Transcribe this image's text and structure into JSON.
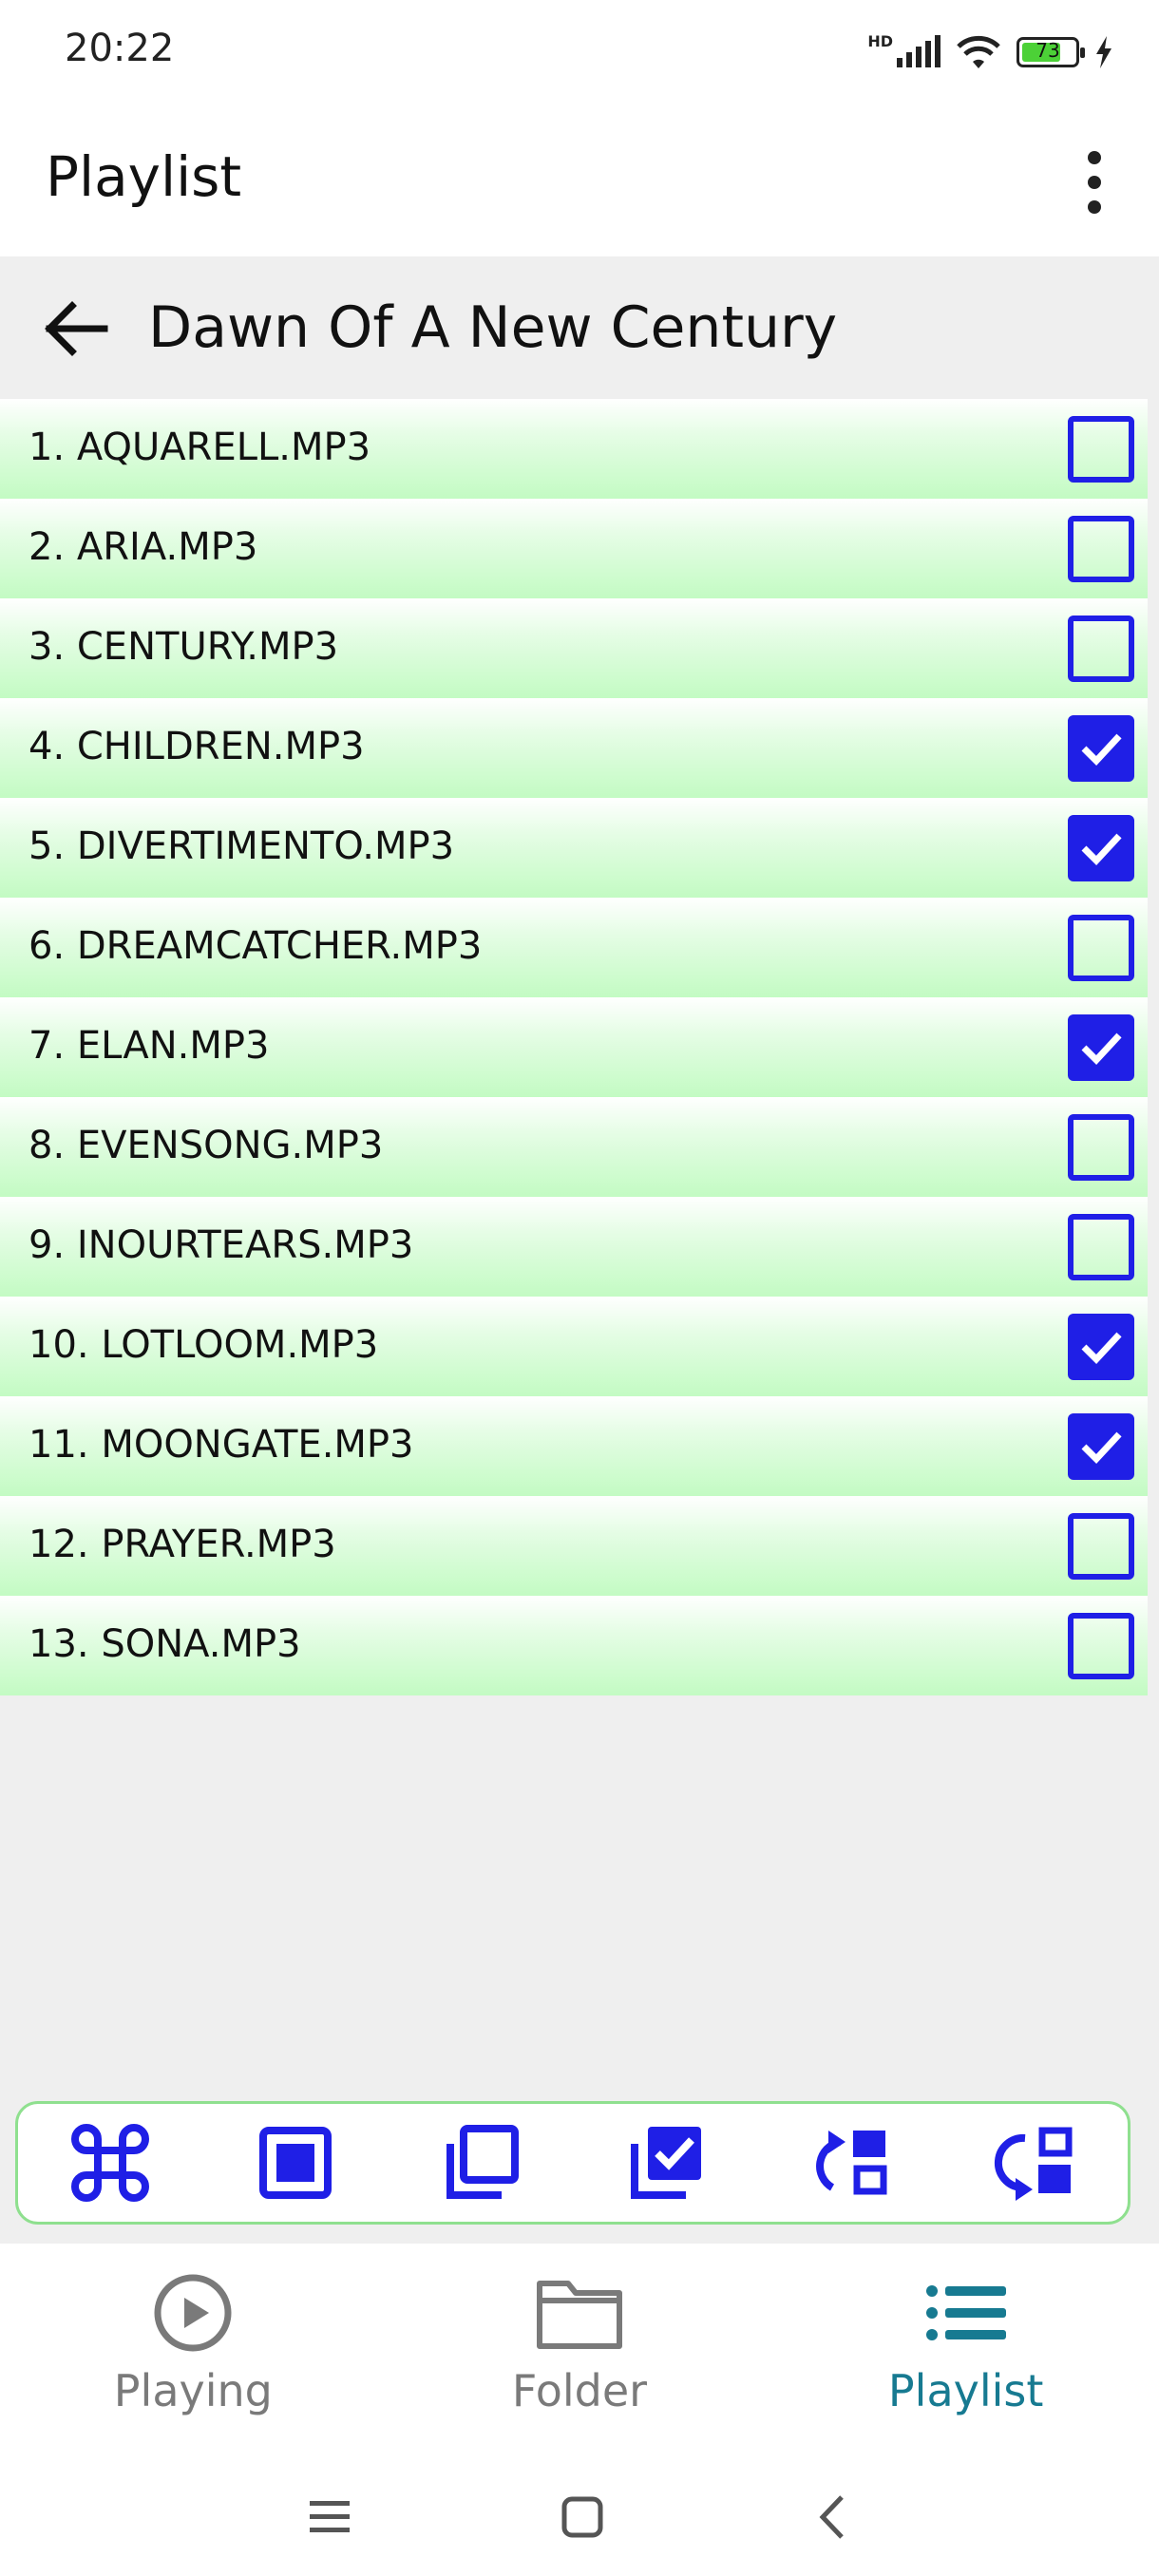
{
  "status": {
    "time": "20:22",
    "battery": "73",
    "network": "HD"
  },
  "app_bar": {
    "title": "Playlist"
  },
  "playlist": {
    "name": "Dawn Of A New Century"
  },
  "tracks": [
    {
      "label": "1. AQUARELL.MP3",
      "checked": false
    },
    {
      "label": "2. ARIA.MP3",
      "checked": false
    },
    {
      "label": "3. CENTURY.MP3",
      "checked": false
    },
    {
      "label": "4. CHILDREN.MP3",
      "checked": true
    },
    {
      "label": "5. DIVERTIMENTO.MP3",
      "checked": true
    },
    {
      "label": "6. DREAMCATCHER.MP3",
      "checked": false
    },
    {
      "label": "7. ELAN.MP3",
      "checked": true
    },
    {
      "label": "8. EVENSONG.MP3",
      "checked": false
    },
    {
      "label": "9. INOURTEARS.MP3",
      "checked": false
    },
    {
      "label": "10. LOTLOOM.MP3",
      "checked": true
    },
    {
      "label": "11. MOONGATE.MP3",
      "checked": true
    },
    {
      "label": "12. PRAYER.MP3",
      "checked": false
    },
    {
      "label": "13. SONA.MP3",
      "checked": false
    }
  ],
  "toolbar": {
    "icons": [
      "command-icon",
      "stop-square-icon",
      "copy-icon",
      "checked-copy-icon",
      "redo-swap-icon",
      "undo-swap-icon"
    ]
  },
  "bottom_nav": {
    "items": [
      {
        "label": "Playing",
        "icon": "play-circle-icon"
      },
      {
        "label": "Folder",
        "icon": "folder-icon"
      },
      {
        "label": "Playlist",
        "icon": "list-icon",
        "active": true
      }
    ]
  },
  "colors": {
    "accent": "#1f1fe6",
    "nav_active": "#177a91",
    "row_green": "#c3fbc3"
  }
}
